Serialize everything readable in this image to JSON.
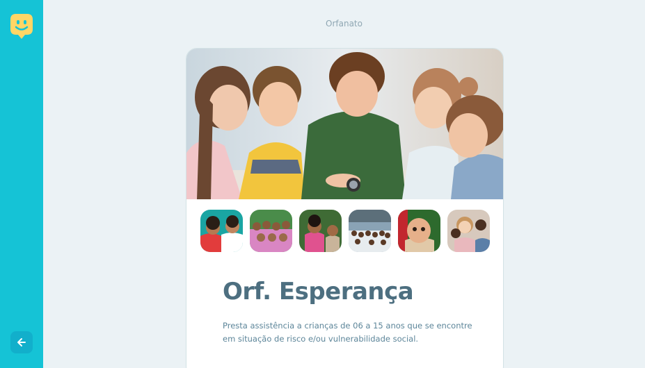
{
  "header": {
    "title": "Orfanato"
  },
  "sidebar": {
    "logo_icon": "happy-face-pin-icon",
    "back_icon": "arrow-left-icon"
  },
  "orphanage": {
    "name": "Orf. Esperança",
    "description": "Presta assistência a crianças de 06 a 15 anos que se encontre em situação de risco e/ou vulnerabilidade social.",
    "images": [
      "hero-photo-children",
      "thumb-1",
      "thumb-2",
      "thumb-3",
      "thumb-4",
      "thumb-5",
      "thumb-6"
    ]
  },
  "colors": {
    "sidebar": "#15c3d6",
    "background": "#ebf2f5",
    "title": "#4d6f80",
    "text": "#5c8599"
  }
}
